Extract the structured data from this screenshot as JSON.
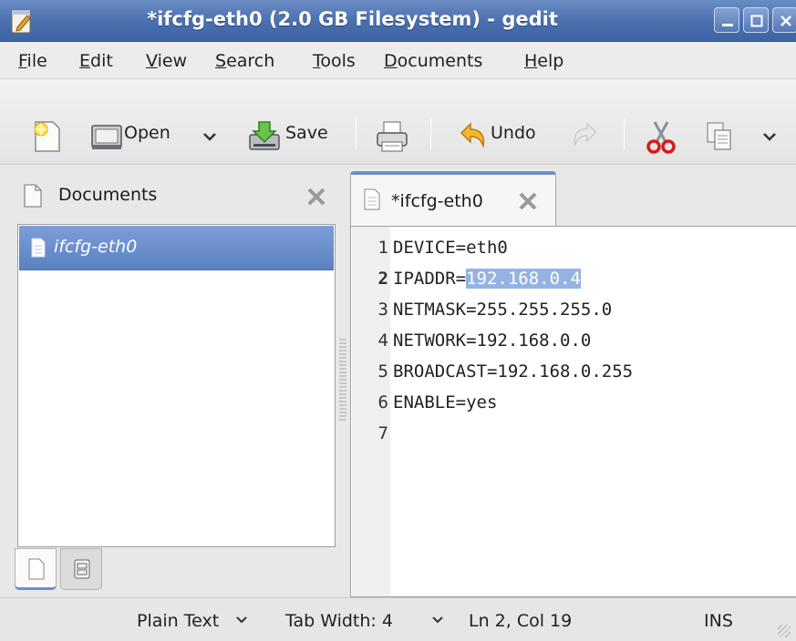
{
  "window": {
    "title": "*ifcfg-eth0 (2.0 GB Filesystem) - gedit"
  },
  "menubar": {
    "items": [
      {
        "mnemonic": "F",
        "rest": "ile"
      },
      {
        "mnemonic": "E",
        "rest": "dit"
      },
      {
        "mnemonic": "V",
        "rest": "iew"
      },
      {
        "mnemonic": "S",
        "rest": "earch"
      },
      {
        "mnemonic": "T",
        "rest": "ools"
      },
      {
        "mnemonic": "D",
        "rest": "ocuments"
      },
      {
        "mnemonic": "H",
        "rest": "elp"
      }
    ]
  },
  "toolbar": {
    "open_label": "Open",
    "save_label": "Save",
    "undo_label": "Undo"
  },
  "side_panel": {
    "title": "Documents",
    "documents": [
      "ifcfg-eth0"
    ]
  },
  "editor": {
    "tab_label": "*ifcfg-eth0",
    "line_numbers": [
      "1",
      "2",
      "3",
      "4",
      "5",
      "6",
      "7"
    ],
    "lines": [
      "DEVICE=eth0",
      "IPADDR=",
      "NETMASK=255.255.255.0",
      "NETWORK=192.168.0.0",
      "BROADCAST=192.168.0.255",
      "ENABLE=yes",
      ""
    ],
    "selected_text": "192.168.0.4"
  },
  "statusbar": {
    "language": "Plain Text",
    "tab_width": "Tab Width:  4",
    "cursor_position": "Ln 2, Col 19",
    "insert_mode": "INS"
  },
  "colors": {
    "titlebar": "#4a6fae",
    "selection": "#94b3e3",
    "accent": "#6b8fc9"
  }
}
